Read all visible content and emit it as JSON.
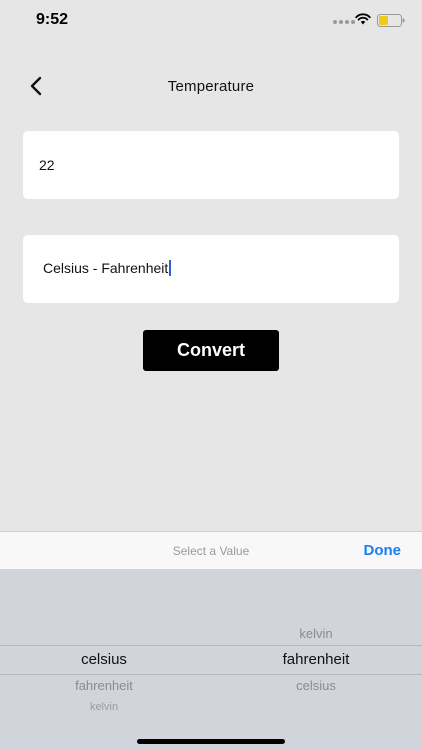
{
  "status_bar": {
    "time": "9:52"
  },
  "nav": {
    "title": "Temperature"
  },
  "form": {
    "value_input": "22",
    "unit_field": "Celsius - Fahrenheit",
    "convert_label": "Convert"
  },
  "picker_toolbar": {
    "hint": "Select a Value",
    "done_label": "Done"
  },
  "picker": {
    "left_column": {
      "selected": "celsius",
      "below_1": "fahrenheit",
      "below_2": "kelvin"
    },
    "right_column": {
      "above_1": "kelvin",
      "selected": "fahrenheit",
      "below_1": "celsius"
    }
  },
  "colors": {
    "accent": "#1a7ef0",
    "caret": "#2f5fd0",
    "battery_fill": "#f2c81c"
  }
}
